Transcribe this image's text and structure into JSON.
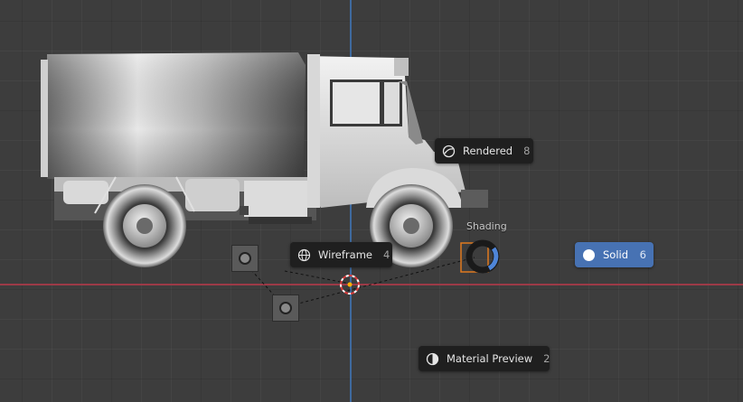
{
  "pie_menu": {
    "title": "Shading",
    "items": [
      {
        "id": "rendered",
        "label": "Rendered",
        "shortcut": "8",
        "icon": "rendered-shading-icon"
      },
      {
        "id": "wireframe",
        "label": "Wireframe",
        "shortcut": "4",
        "icon": "wireframe-shading-icon"
      },
      {
        "id": "solid",
        "label": "Solid",
        "shortcut": "6",
        "icon": "solid-shading-icon",
        "active": true
      },
      {
        "id": "material_preview",
        "label": "Material Preview",
        "shortcut": "2",
        "icon": "material-preview-icon"
      }
    ]
  },
  "scene": {
    "objects": [
      "truck-model",
      "light-object",
      "camera-object",
      "3d-cursor"
    ]
  },
  "colors": {
    "background": "#3d3d3d",
    "x_axis": "#9c3a47",
    "y_axis": "#3f6a9e",
    "active_item": "#4772b3",
    "pie_item_bg": "#1f1f1f",
    "selection_outline": "#e07a1f"
  }
}
